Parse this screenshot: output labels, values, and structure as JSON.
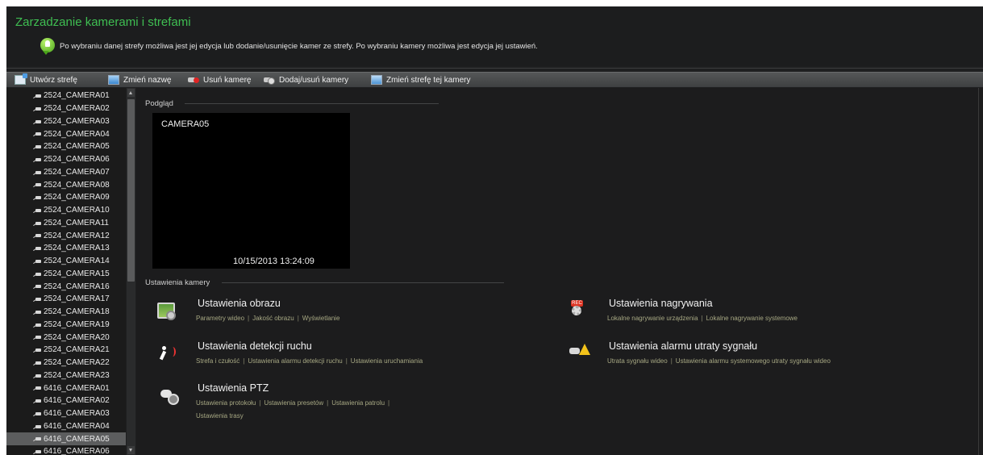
{
  "header": {
    "title": "Zarzadzanie kamerami i strefami",
    "info": "Po wybraniu danej strefy możliwa jest jej edycja lub dodanie/usunięcie kamer ze strefy. Po wybraniu kamery możliwa jest edycja jej ustawień."
  },
  "toolbar": {
    "create_zone": "Utwórz strefę",
    "rename": "Zmień nazwę",
    "delete_camera": "Usuń kamerę",
    "add_remove_cameras": "Dodaj/usuń kamery",
    "change_zone": "Zmień strefę tej kamery"
  },
  "cameras": [
    "2524_CAMERA01",
    "2524_CAMERA02",
    "2524_CAMERA03",
    "2524_CAMERA04",
    "2524_CAMERA05",
    "2524_CAMERA06",
    "2524_CAMERA07",
    "2524_CAMERA08",
    "2524_CAMERA09",
    "2524_CAMERA10",
    "2524_CAMERA11",
    "2524_CAMERA12",
    "2524_CAMERA13",
    "2524_CAMERA14",
    "2524_CAMERA15",
    "2524_CAMERA16",
    "2524_CAMERA17",
    "2524_CAMERA18",
    "2524_CAMERA19",
    "2524_CAMERA20",
    "2524_CAMERA21",
    "2524_CAMERA22",
    "2524_CAMERA23",
    "6416_CAMERA01",
    "6416_CAMERA02",
    "6416_CAMERA03",
    "6416_CAMERA04",
    "6416_CAMERA05",
    "6416_CAMERA06"
  ],
  "selected_camera": "6416_CAMERA05",
  "preview": {
    "label": "Podgląd",
    "camera_name": "CAMERA05",
    "timestamp": "10/15/2013 13:24:09"
  },
  "settings": {
    "label": "Ustawienia kamery",
    "image": {
      "title": "Ustawienia obrazu",
      "links": [
        "Parametry wideo",
        "Jakość obrazu",
        "Wyświetlanie"
      ]
    },
    "recording": {
      "title": "Ustawienia nagrywania",
      "links": [
        "Lokalne nagrywanie urządzenia",
        "Lokalne nagrywanie systemowe"
      ]
    },
    "motion": {
      "title": "Ustawienia detekcji ruchu",
      "links": [
        "Strefa i czułość",
        "Ustawienia alarmu detekcji ruchu",
        "Ustawienia uruchamiania"
      ]
    },
    "signal_loss": {
      "title": "Ustawienia alarmu utraty sygnału",
      "links": [
        "Utrata sygnału wideo",
        "Ustawienia alarmu systemowego utraty sygnału wideo"
      ]
    },
    "ptz": {
      "title": "Ustawienia PTZ",
      "links": [
        "Ustawienia protokołu",
        "Ustawienia presetów",
        "Ustawienia patrolu",
        "Ustawienia trasy"
      ]
    }
  },
  "icons": {
    "info": "info-bulb-icon",
    "rec_tag": "REC"
  },
  "colors": {
    "title_green": "#3fbe52",
    "link_olive": "#a7a883",
    "background": "#1c1c1d"
  }
}
